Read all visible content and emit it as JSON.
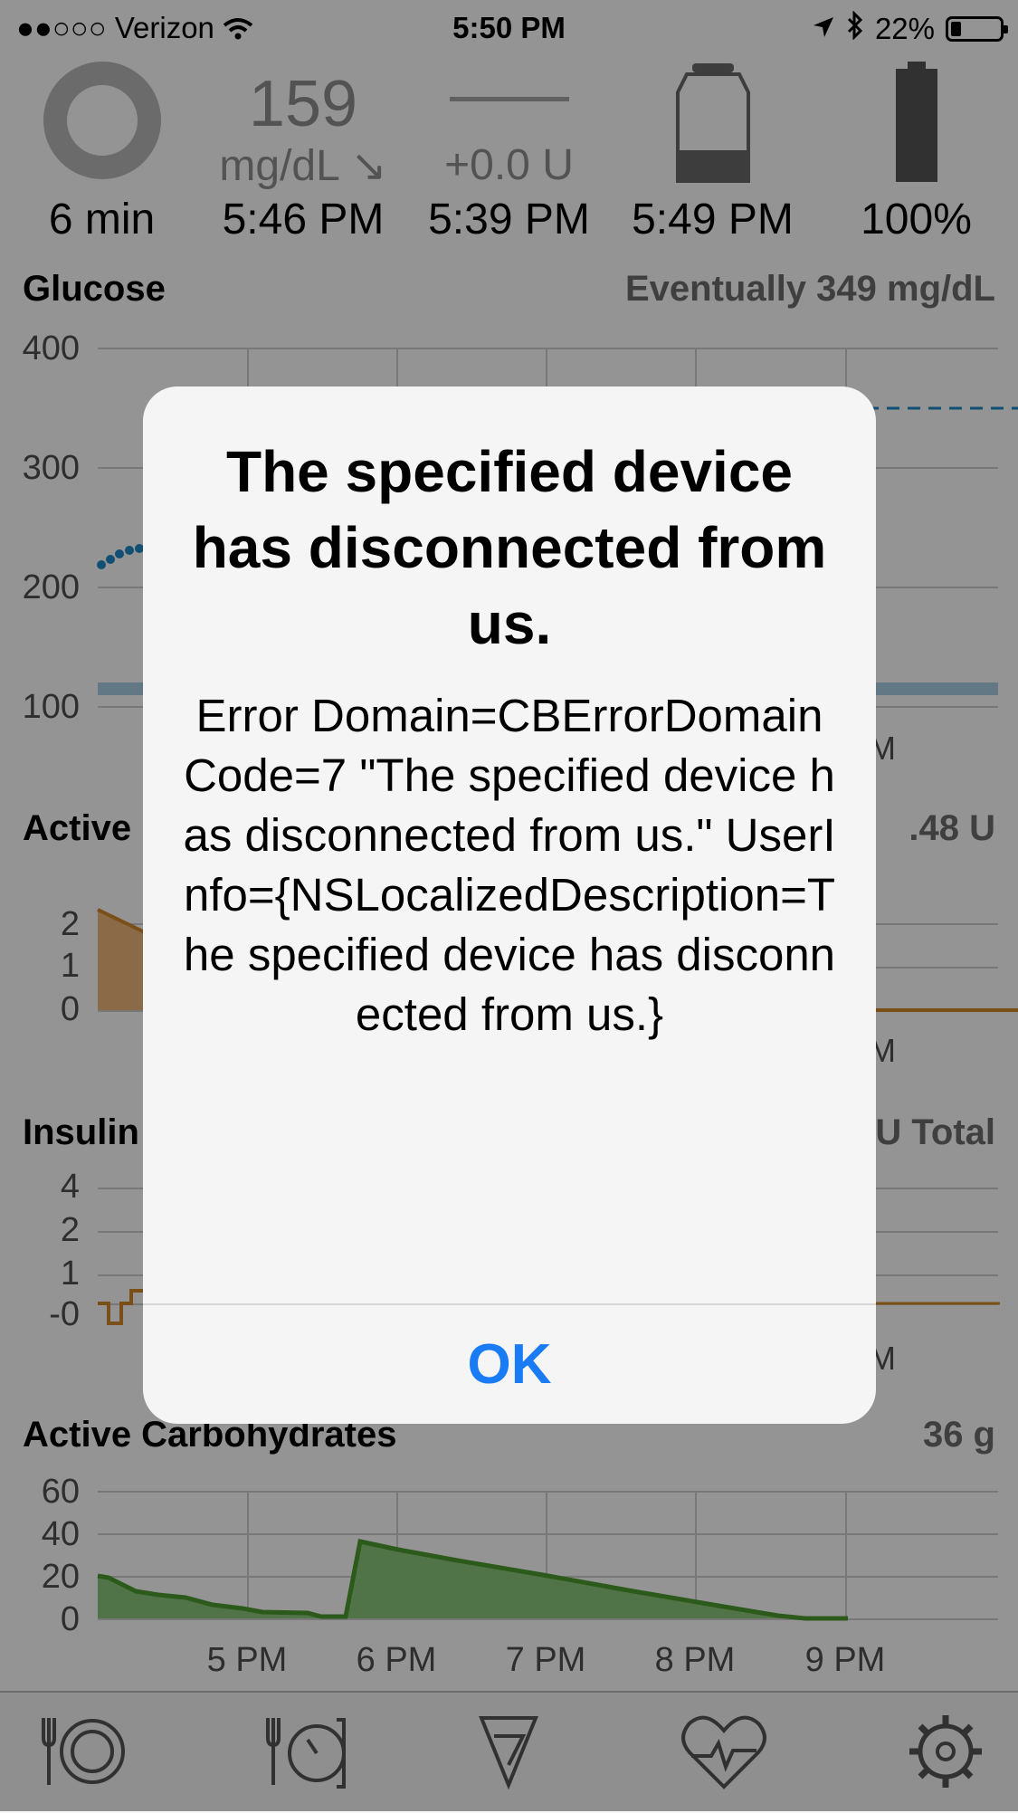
{
  "status_bar": {
    "signal": "●●○○○",
    "carrier": "Verizon",
    "time": "5:50 PM",
    "battery_text": "22%",
    "battery_level": 0.22
  },
  "hud": {
    "loop": {
      "value": "6 min"
    },
    "glucose": {
      "value": "159",
      "unit": "mg/dL",
      "trend": "↘",
      "time": "5:46 PM"
    },
    "temp_basal": {
      "placeholder": "—",
      "delta": "+0.0 U",
      "time": "5:39 PM"
    },
    "reservoir": {
      "time": "5:49 PM",
      "level": 0.35
    },
    "pump_battery": {
      "value": "100%",
      "level": 1.0
    }
  },
  "sections": {
    "glucose": {
      "title": "Glucose",
      "right": "Eventually 349 mg/dL",
      "y_ticks": [
        "400",
        "300",
        "200",
        "100"
      ],
      "x_fragment": "M"
    },
    "active_insulin": {
      "title_fragment": "Active",
      "right_fragment": ".48 U",
      "y_ticks": [
        "2",
        "1",
        "0"
      ],
      "x_fragment": "M"
    },
    "insulin_delivery": {
      "title_fragment": "Insulin",
      "right_fragment": "U Total",
      "y_ticks": [
        "4",
        "2",
        "1",
        "-0"
      ],
      "x_fragment": "M"
    },
    "active_carbs": {
      "title": "Active Carbohydrates",
      "right": "36 g",
      "y_ticks": [
        "60",
        "40",
        "20",
        "0"
      ],
      "x_ticks": [
        "5 PM",
        "6 PM",
        "7 PM",
        "8 PM",
        "9 PM"
      ]
    }
  },
  "colors": {
    "glucose_points": "#1f88c9",
    "target_range": "#a9cfe6",
    "insulin": "#d4882a",
    "insulin_fill": "#f0b87a",
    "carbs": "#4a9b30",
    "carbs_fill": "#8bc97a",
    "ok_button": "#1a7cf4"
  },
  "tabbar": {
    "items": [
      "carbs-icon",
      "bolus-icon",
      "pump-icon",
      "health-icon",
      "settings-icon"
    ]
  },
  "alert": {
    "title": "The specified device has disconnected from us.",
    "message": "Error Domain=CBErrorDomain Code=7 \"The specified device has disconnected from us.\" UserInfo={NSLocalizedDescription=The specified device has disconnected from us.}",
    "ok_label": "OK"
  }
}
